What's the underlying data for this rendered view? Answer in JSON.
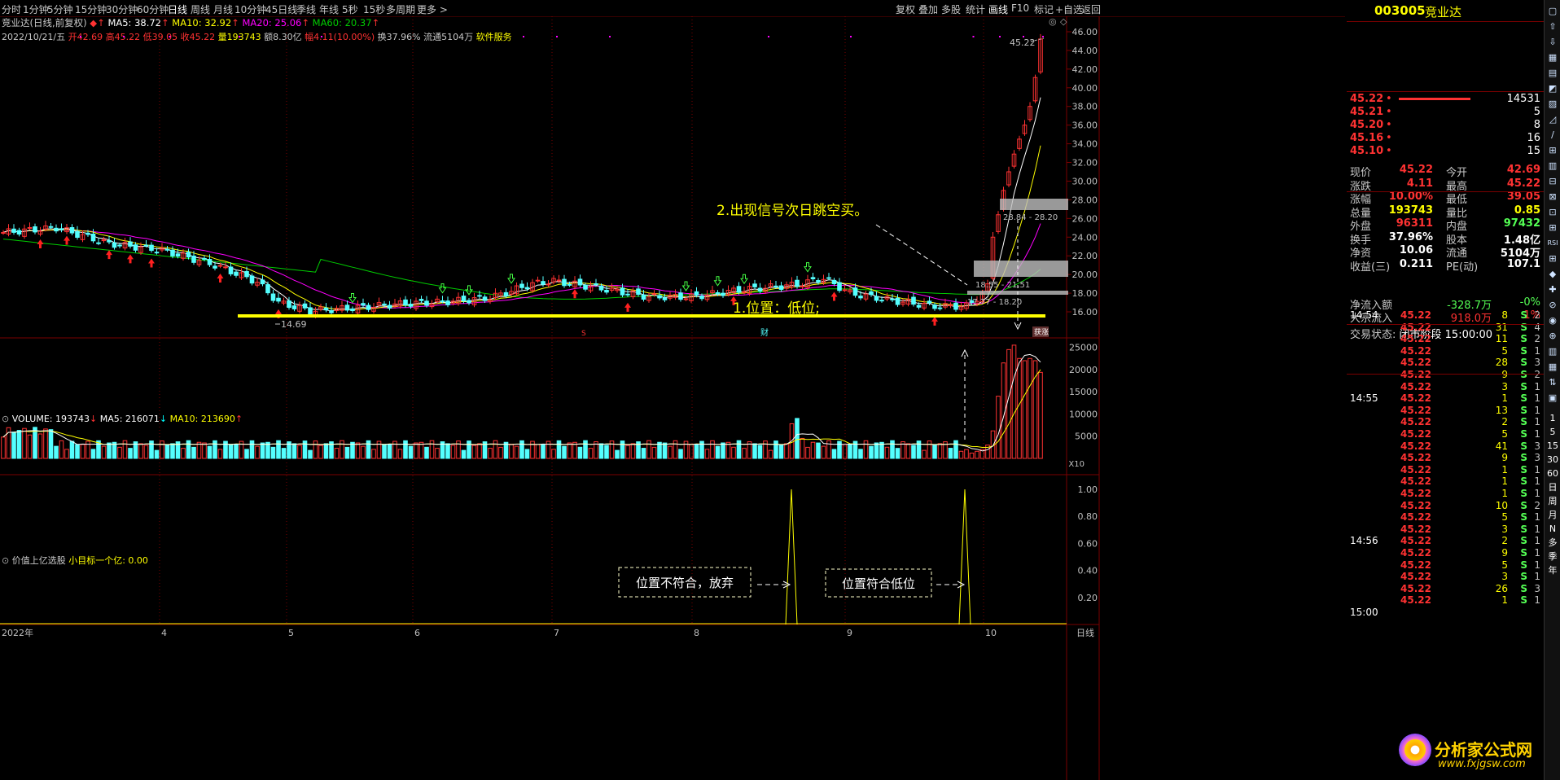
{
  "periods": [
    "分时",
    "1分钟",
    "5分钟",
    "15分钟",
    "30分钟",
    "60分钟",
    "日线",
    "周线",
    "月线",
    "10分钟",
    "45日线",
    "季线",
    "年线",
    "5秒",
    "15秒",
    "多周期",
    "更多"
  ],
  "selected_period": "日线",
  "right_tools": [
    "复权",
    "叠加",
    "多股",
    "统计",
    "画线",
    "F10",
    "标记",
    "+自选",
    "返回"
  ],
  "ma_line": {
    "name": "竞业达(日线,前复权)",
    "ma5": "MA5: 38.72",
    "ma10": "MA10: 32.92",
    "ma20": "MA20: 25.06",
    "ma60": "MA60: 20.37"
  },
  "date_line": {
    "date": "2022/10/21/五",
    "open": "开42.69",
    "high": "高45.22",
    "low": "低39.05",
    "close": "收45.22",
    "vol": "量193743",
    "amt": "额8.30亿",
    "chg": "幅4.11(10.00%)",
    "turn": "换37.96%",
    "float": "流通5104万",
    "sector": "软件服务"
  },
  "price_axis": [
    "46.00",
    "44.00",
    "42.00",
    "40.00",
    "38.00",
    "36.00",
    "34.00",
    "32.00",
    "30.00",
    "28.00",
    "26.00",
    "24.00",
    "22.00",
    "20.00",
    "18.00",
    "16.00"
  ],
  "annotations": {
    "signal": "2.出现信号次日跳空买。",
    "position": "1.位置：低位;",
    "low": "14.69",
    "hi": "45.22",
    "box1": "28.84 - 28.20",
    "box2": "18.55 - 21.51",
    "box3": "17.77 - 18.20",
    "mark_s": "S",
    "mark_cai": "财",
    "mark_cai2": "获涨"
  },
  "volume_line": {
    "vol": "VOLUME: 193743",
    "ma5": "MA5: 216071",
    "ma10": "MA10: 213690"
  },
  "volume_axis": [
    "25000",
    "20000",
    "15000",
    "10000",
    "5000"
  ],
  "volume_unit": "X10",
  "indicator_line": {
    "name": "价值上亿选股",
    "sub": "小目标一个亿: 0.00"
  },
  "indicator_axis": [
    "1.00",
    "0.80",
    "0.60",
    "0.40",
    "0.20"
  ],
  "indicator_notes": {
    "reject": "位置不符合，放弃",
    "match": "位置符合低位"
  },
  "date_axis": [
    "2022年",
    "4",
    "5",
    "6",
    "7",
    "8",
    "9",
    "10"
  ],
  "bottom_right": "日线",
  "stock": {
    "code": "003005",
    "name": "竞业达"
  },
  "order_book": [
    {
      "p": "45.22",
      "v": "14531"
    },
    {
      "p": "45.21",
      "v": "5"
    },
    {
      "p": "45.20",
      "v": "8"
    },
    {
      "p": "45.16",
      "v": "16"
    },
    {
      "p": "45.10",
      "v": "15"
    }
  ],
  "quote": [
    [
      "现价",
      "45.22",
      "今开",
      "42.69"
    ],
    [
      "涨跌",
      "4.11",
      "最高",
      "45.22"
    ],
    [
      "涨幅",
      "10.00%",
      "最低",
      "39.05"
    ],
    [
      "总量",
      "193743",
      "量比",
      "0.85"
    ],
    [
      "外盘",
      "96311",
      "内盘",
      "97432"
    ],
    [
      "换手",
      "37.96%",
      "股本",
      "1.48亿"
    ],
    [
      "净资",
      "10.06",
      "流通",
      "5104万"
    ],
    [
      "收益(三)",
      "0.211",
      "PE(动)",
      "107.1"
    ]
  ],
  "status": {
    "label": "交易状态:",
    "value": "闭市阶段 15:00:00"
  },
  "flows": [
    {
      "l": "净流入额",
      "v": "-328.7万",
      "p": "-0%"
    },
    {
      "l": "大宗流入",
      "v": "918.0万",
      "p": "1%"
    }
  ],
  "ticks": [
    {
      "t": "14:54",
      "p": "45.22",
      "v": "8",
      "s": "S",
      "n": "2"
    },
    {
      "t": "",
      "p": "45.22",
      "v": "31",
      "s": "S",
      "n": "4"
    },
    {
      "t": "",
      "p": "45.22",
      "v": "11",
      "s": "S",
      "n": "2"
    },
    {
      "t": "",
      "p": "45.22",
      "v": "5",
      "s": "S",
      "n": "1"
    },
    {
      "t": "",
      "p": "45.22",
      "v": "28",
      "s": "S",
      "n": "3"
    },
    {
      "t": "",
      "p": "45.22",
      "v": "9",
      "s": "S",
      "n": "2"
    },
    {
      "t": "",
      "p": "45.22",
      "v": "3",
      "s": "S",
      "n": "1"
    },
    {
      "t": "14:55",
      "p": "45.22",
      "v": "1",
      "s": "S",
      "n": "1"
    },
    {
      "t": "",
      "p": "45.22",
      "v": "13",
      "s": "S",
      "n": "1"
    },
    {
      "t": "",
      "p": "45.22",
      "v": "2",
      "s": "S",
      "n": "1"
    },
    {
      "t": "",
      "p": "45.22",
      "v": "5",
      "s": "S",
      "n": "1"
    },
    {
      "t": "",
      "p": "45.22",
      "v": "41",
      "s": "S",
      "n": "3"
    },
    {
      "t": "",
      "p": "45.22",
      "v": "9",
      "s": "S",
      "n": "3"
    },
    {
      "t": "",
      "p": "45.22",
      "v": "1",
      "s": "S",
      "n": "1"
    },
    {
      "t": "",
      "p": "45.22",
      "v": "1",
      "s": "S",
      "n": "1"
    },
    {
      "t": "",
      "p": "45.22",
      "v": "1",
      "s": "S",
      "n": "1"
    },
    {
      "t": "",
      "p": "45.22",
      "v": "10",
      "s": "S",
      "n": "2"
    },
    {
      "t": "",
      "p": "45.22",
      "v": "5",
      "s": "S",
      "n": "1"
    },
    {
      "t": "",
      "p": "45.22",
      "v": "3",
      "s": "S",
      "n": "1"
    },
    {
      "t": "14:56",
      "p": "45.22",
      "v": "2",
      "s": "S",
      "n": "1"
    },
    {
      "t": "",
      "p": "45.22",
      "v": "9",
      "s": "S",
      "n": "1"
    },
    {
      "t": "",
      "p": "45.22",
      "v": "5",
      "s": "S",
      "n": "1"
    },
    {
      "t": "",
      "p": "45.22",
      "v": "3",
      "s": "S",
      "n": "1"
    },
    {
      "t": "",
      "p": "45.22",
      "v": "26",
      "s": "S",
      "n": "3"
    },
    {
      "t": "",
      "p": "45.22",
      "v": "1",
      "s": "S",
      "n": "1"
    }
  ],
  "tick_last_time": "15:00",
  "side_buttons": [
    "1",
    "5",
    "15",
    "30",
    "60",
    "日",
    "周",
    "月",
    "N",
    "多",
    "季",
    "年"
  ],
  "watermark": {
    "brand": "分析家公式网",
    "url": "www.fxjgsw.com"
  },
  "colors": {
    "up": "#ff3232",
    "down": "#54ffff",
    "ma5": "#ffffff",
    "ma10": "#ffff00",
    "ma20": "#ff00ff",
    "ma60": "#00cc00",
    "grid": "#7a0000",
    "yellow": "#ffff00"
  }
}
